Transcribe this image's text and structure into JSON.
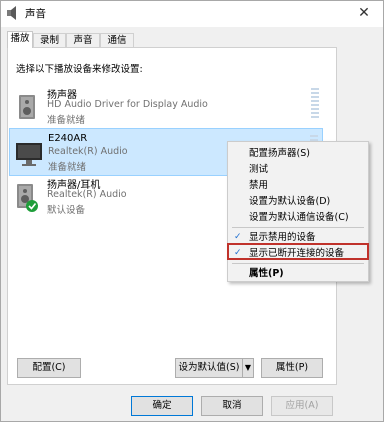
{
  "window": {
    "title": "声音",
    "close_glyph": "✕"
  },
  "tabs": [
    {
      "label": "播放",
      "active": true
    },
    {
      "label": "录制",
      "active": false
    },
    {
      "label": "声音",
      "active": false
    },
    {
      "label": "通信",
      "active": false
    }
  ],
  "instruction": "选择以下播放设备来修改设置:",
  "devices": [
    {
      "name": "扬声器",
      "driver": "HD Audio Driver for Display Audio",
      "status": "准备就绪",
      "icon": "speaker-icon",
      "selected": false
    },
    {
      "name": "E240AR",
      "driver": "Realtek(R) Audio",
      "status": "准备就绪",
      "icon": "monitor-icon",
      "selected": true
    },
    {
      "name": "扬声器/耳机",
      "driver": "Realtek(R) Audio",
      "status": "默认设备",
      "icon": "speaker-default-icon",
      "selected": false
    }
  ],
  "buttons": {
    "configure": "配置(C)",
    "set_default": "设为默认值(S)",
    "dropdown_glyph": "▼",
    "properties": "属性(P)",
    "ok": "确定",
    "cancel": "取消",
    "apply": "应用(A)"
  },
  "context_menu": {
    "items": [
      {
        "label": "配置扬声器(S)"
      },
      {
        "label": "测试"
      },
      {
        "label": "禁用"
      },
      {
        "label": "设置为默认设备(D)"
      },
      {
        "label": "设置为默认通信设备(C)"
      }
    ],
    "show_disabled": {
      "label": "显示禁用的设备",
      "checked": true
    },
    "show_disconnected": {
      "label": "显示已断开连接的设备",
      "checked": true
    },
    "properties": {
      "label": "属性(P)"
    },
    "check_glyph": "✓"
  },
  "colors": {
    "selection": "#cce8ff",
    "highlight_border": "#c0322b",
    "check": "#1e6fd0"
  }
}
